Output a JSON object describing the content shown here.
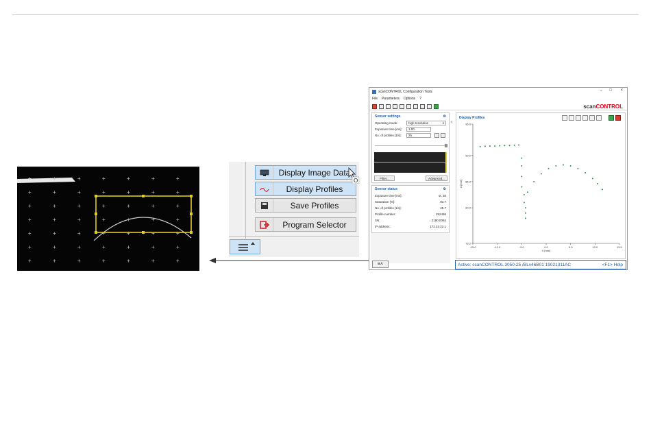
{
  "menu_zoom": {
    "items": [
      {
        "label": "Display Image Data",
        "icon": "monitor-icon"
      },
      {
        "label": "Display Profiles",
        "icon": "profile-wave-icon"
      },
      {
        "label": "Save Profiles",
        "icon": "floppy-disk-icon"
      },
      {
        "label": "Program Selector",
        "icon": "exit-door-icon"
      }
    ],
    "cursor_fragment": "O"
  },
  "app": {
    "title": "scanCONTROL Configuration Tools",
    "menu": [
      "File",
      "Parameters",
      "Options",
      "?"
    ],
    "brand_prefix": "scan",
    "brand_suffix": "CONTROL",
    "sensor_settings": {
      "title": "Sensor settings",
      "operating_mode_label": "Operating mode:",
      "operating_mode_value": "high resolution",
      "exposure_label": "Exposure time [ms]:",
      "exposure_value": "1.00",
      "profiles_label": "No. of profiles [1/s]:",
      "profiles_value": "25",
      "filter_button": "Filter...",
      "advanced_button": "Advanced..."
    },
    "sensor_status": {
      "title": "Sensor status",
      "rows": [
        {
          "label": "Exposure time [ms]:",
          "value": "st. 36"
        },
        {
          "label": "Saturation [%]:",
          "value": "83.7"
        },
        {
          "label": "No. of profiles [1/s]:",
          "value": "45.7"
        },
        {
          "label": "Profile number:",
          "value": "252436"
        },
        {
          "label": "SN:",
          "value": "2190.0084"
        },
        {
          "label": "IP address:",
          "value": "172.23.22.1"
        }
      ]
    },
    "plot": {
      "title": "Display Profiles"
    },
    "status": {
      "text": "Active: scanCONTROL 3050-25 /BLv46B01  19021311AC",
      "help": "<F1> Help"
    },
    "colors": {
      "accent": "#1f5fa8",
      "brand_red": "#e3001b",
      "profile_green": "#2e8b4a"
    }
  },
  "chart_data": {
    "type": "scatter",
    "title": "Display Profiles",
    "xlabel": "X [mm]",
    "ylabel": "Z [mm]",
    "x_ticks": [
      "-15.0",
      "-10.0",
      "-5.0",
      "0.0",
      "5.0",
      "10.0",
      "15.0"
    ],
    "y_ticks": [
      "96.0",
      "90.0",
      "85.0",
      "80.0",
      "73.2"
    ],
    "xlim": [
      -15,
      15
    ],
    "ylim": [
      73.2,
      96
    ],
    "series": [
      {
        "color": "#2e8b4a",
        "x": [
          -13.5,
          -12.5,
          -11.5,
          -10.5,
          -9.5,
          -8.5,
          -7.5,
          -6.5,
          -5.6,
          -5.0,
          -5.0,
          -5.0,
          -5.0,
          -4.5,
          -4.5,
          -4.2,
          -4.2,
          -4.2,
          -3.8,
          -2.5,
          -1.0,
          0.5,
          2.0,
          3.5,
          5.0,
          6.5,
          8.0,
          9.5,
          10.5,
          11.5
        ],
        "y": [
          91.7,
          91.75,
          91.8,
          91.8,
          91.85,
          91.9,
          91.9,
          91.95,
          92.0,
          89.5,
          88.0,
          86.0,
          84.0,
          82.5,
          81.0,
          80.0,
          79.0,
          78.0,
          83.0,
          85.0,
          86.5,
          87.5,
          88.0,
          88.2,
          88.0,
          87.5,
          86.7,
          85.6,
          84.6,
          83.5
        ]
      }
    ]
  }
}
